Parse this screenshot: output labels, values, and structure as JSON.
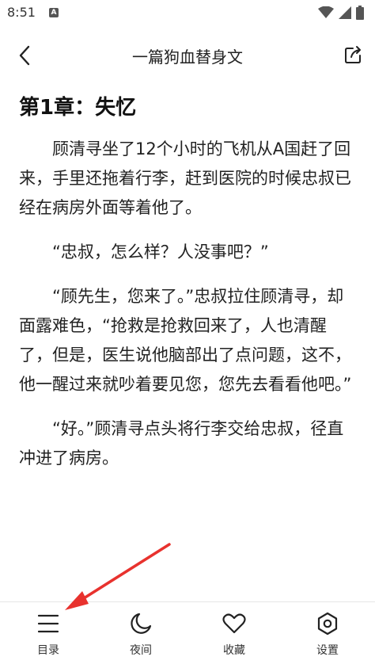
{
  "status_bar": {
    "time": "8:51",
    "notification_icon_letter": "A"
  },
  "header": {
    "title": "一篇狗血替身文"
  },
  "content": {
    "chapter_title": "第1章：失忆",
    "paragraphs": [
      "顾清寻坐了12个小时的飞机从A国赶了回来，手里还拖着行李，赶到医院的时候忠叔已经在病房外面等着他了。",
      "“忠叔，怎么样？人没事吧？”",
      "“顾先生，您来了。”忠叔拉住顾清寻，却面露难色，“抢救是抢救回来了，人也清醒了，但是，医生说他脑部出了点问题，这不，他一醒过来就吵着要见您，您先去看看他吧。”",
      "“好。”顾清寻点头将行李交给忠叔，径直冲进了病房。"
    ]
  },
  "bottom_bar": {
    "items": [
      {
        "label": "目录",
        "icon": "menu-icon"
      },
      {
        "label": "夜间",
        "icon": "moon-icon"
      },
      {
        "label": "收藏",
        "icon": "heart-icon"
      },
      {
        "label": "设置",
        "icon": "settings-icon"
      }
    ]
  },
  "colors": {
    "annotation_arrow": "#e8322e",
    "text": "#222222",
    "background": "#ffffff"
  }
}
